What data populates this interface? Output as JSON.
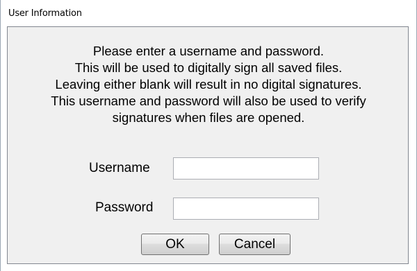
{
  "window": {
    "title": "User Information"
  },
  "message": {
    "lines": [
      "Please enter a username and password.",
      "This will be used to digitally sign all saved files.",
      "Leaving either blank will result in no digital signatures.",
      "This username and password will also be used to verify",
      "signatures when files are opened."
    ]
  },
  "form": {
    "username_label": "Username",
    "username_value": "",
    "password_label": "Password",
    "password_value": ""
  },
  "buttons": {
    "ok_label": "OK",
    "cancel_label": "Cancel"
  }
}
